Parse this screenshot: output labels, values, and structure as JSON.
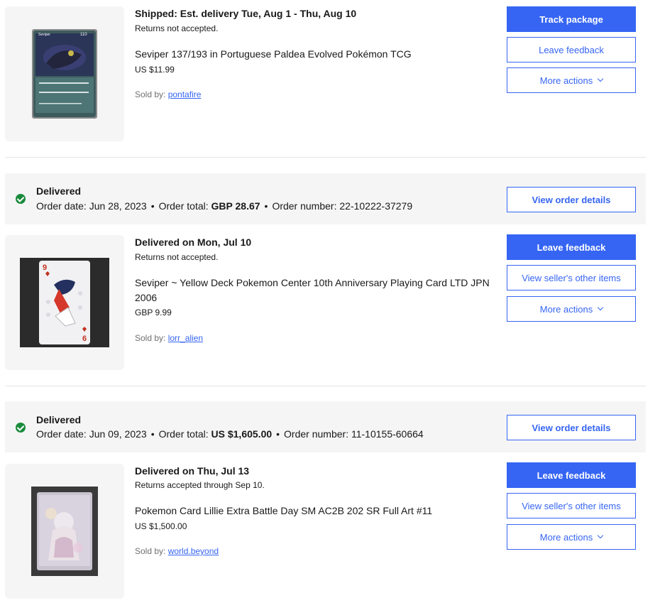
{
  "orders": [
    {
      "shipping_status": "Shipped: Est. delivery Tue, Aug 1 - Thu, Aug 10",
      "returns": "Returns not accepted.",
      "item_title": "Seviper 137/193 in Portuguese Paldea Evolved Pokémon TCG",
      "price": "US $11.99",
      "sold_by_label": "Sold by:",
      "seller": "pontafire",
      "card_thumb_name": "Seviper",
      "card_thumb_hp": "110",
      "actions": [
        "Track package",
        "Leave feedback",
        "More actions"
      ]
    },
    {
      "status": "Delivered",
      "order_date_label": "Order date:",
      "order_date": "Jun 28, 2023",
      "order_total_label": "Order total:",
      "order_total": "GBP 28.67",
      "order_number_label": "Order number:",
      "order_number": "22-10222-37279",
      "view_details": "View order details",
      "shipping_status": "Delivered on Mon, Jul 10",
      "returns": "Returns not accepted.",
      "item_title": "Seviper ~ Yellow Deck Pokemon Center 10th Anniversary Playing Card LTD JPN 2006",
      "price": "GBP 9.99",
      "sold_by_label": "Sold by:",
      "seller": "lorr_alien",
      "card_rank": "9",
      "card_rank_bottom": "6",
      "actions": [
        "Leave feedback",
        "View seller's other items",
        "More actions"
      ]
    },
    {
      "status": "Delivered",
      "order_date_label": "Order date:",
      "order_date": "Jun 09, 2023",
      "order_total_label": "Order total:",
      "order_total": "US $1,605.00",
      "order_number_label": "Order number:",
      "order_number": "11-10155-60664",
      "view_details": "View order details",
      "shipping_status": "Delivered on Thu, Jul 13",
      "returns": "Returns accepted through Sep 10.",
      "item_title": "Pokemon Card Lillie Extra Battle Day SM AC2B 202 SR Full Art #11",
      "price": "US $1,500.00",
      "sold_by_label": "Sold by:",
      "seller": "world.beyond",
      "actions": [
        "Leave feedback",
        "View seller's other items",
        "More actions"
      ]
    }
  ],
  "colors": {
    "accent": "#3665f3",
    "success": "#1a8b3c",
    "panel": "#f5f5f5"
  },
  "icons": [
    "check-circle-icon",
    "chevron-down-icon"
  ]
}
